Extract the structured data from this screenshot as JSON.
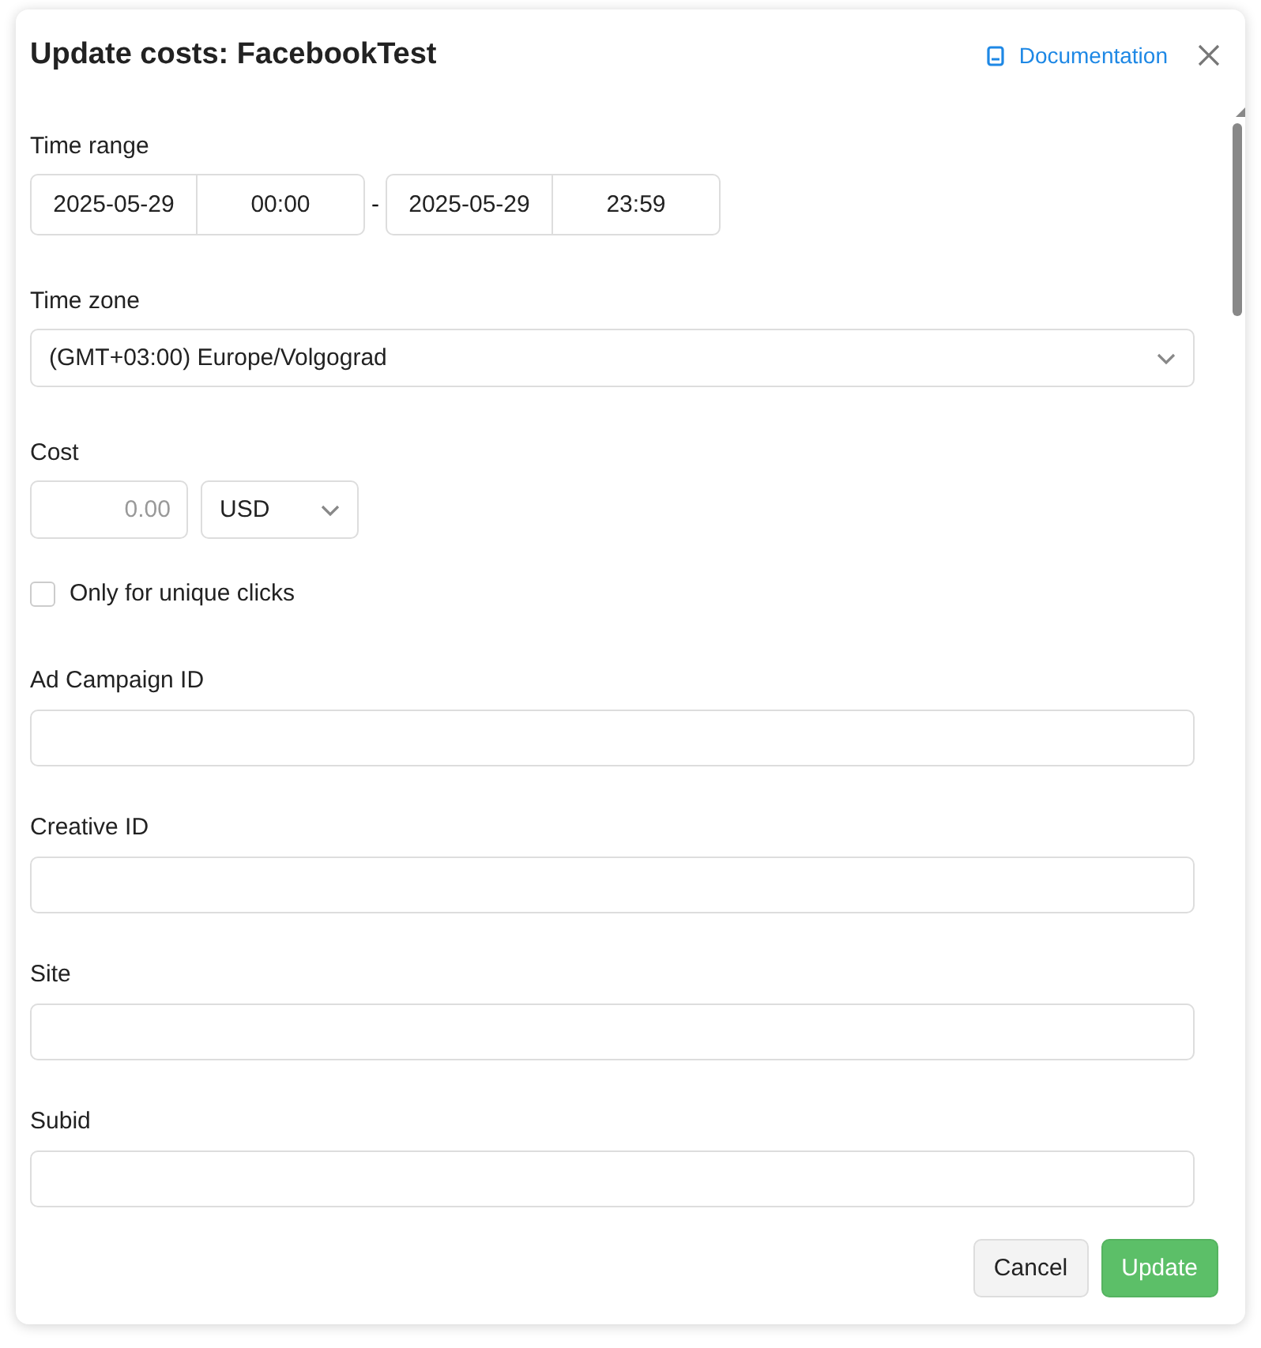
{
  "dialog": {
    "title": "Update costs: FacebookTest",
    "documentation_link": "Documentation"
  },
  "time_range": {
    "label": "Time range",
    "start_date": "2025-05-29",
    "start_time": "00:00",
    "separator": "-",
    "end_date": "2025-05-29",
    "end_time": "23:59"
  },
  "time_zone": {
    "label": "Time zone",
    "value": "(GMT+03:00) Europe/Volgograd"
  },
  "cost": {
    "label": "Cost",
    "placeholder": "0.00",
    "currency": "USD"
  },
  "unique_clicks": {
    "label": "Only for unique clicks",
    "checked": false
  },
  "text_fields": [
    {
      "label": "Ad Campaign ID"
    },
    {
      "label": "Creative ID"
    },
    {
      "label": "Site"
    },
    {
      "label": "Subid"
    }
  ],
  "buttons": [
    {
      "label": "Cancel",
      "kind": "secondary"
    },
    {
      "label": "Update",
      "kind": "primary"
    }
  ]
}
